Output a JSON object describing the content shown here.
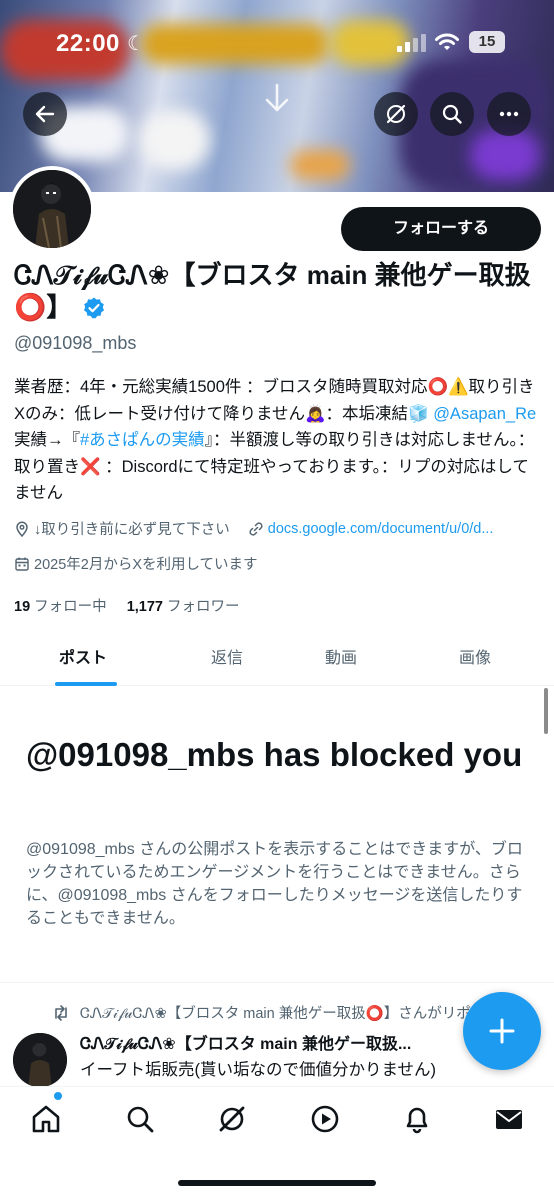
{
  "status_bar": {
    "time": "22:00",
    "battery": "15"
  },
  "profile": {
    "follow_button": "フォローする",
    "display_name": "ᏣᏁ𝒯𝒾𝒻𝓊ᏣᏁ❀【ブロスタ main 兼他ゲー取扱⭕️】",
    "handle": "@091098_mbs",
    "bio": {
      "part1": "業者歴：4年・元総実績1500件 ：ブロスタ随時買取対応⭕️⚠️取り引きXのみ：低レート受け付けて降りません🙇‍♀️：本垢凍結🧊 ",
      "mention": "@Asapan_Re",
      "part2": " 実績→『",
      "hashtag": "#あさぱんの実績",
      "part3": "』：半額渡し等の取り引きは対応しません。：取り置き❌ ：Discordにて特定班やっております。：リプの対応はしてません"
    },
    "location": "↓取り引き前に必ず見て下さい",
    "website": "docs.google.com/document/u/0/d...",
    "joined": "2025年2月からXを利用しています",
    "following_count": "19",
    "following_label": "フォロー中",
    "followers_count": "1,177",
    "followers_label": "フォロワー"
  },
  "tabs": [
    {
      "label": "ポスト",
      "active": true
    },
    {
      "label": "返信",
      "active": false
    },
    {
      "label": "動画",
      "active": false
    },
    {
      "label": "画像",
      "active": false
    }
  ],
  "blocked": {
    "title": "@091098_mbs has blocked you",
    "body": "@091098_mbs さんの公開ポストを表示することはできますが、ブロックされているためエンゲージメントを行うことはできません。さらに、@091098_mbs さんをフォローしたりメッセージを送信したりすることもできません。"
  },
  "post": {
    "repost_line": "ᏣᏁ𝒯𝒾𝒻𝓊ᏣᏁ❀【ブロスタ main 兼他ゲー取扱⭕️】さんがリポスト",
    "author_name": "ᏣᏁ𝒯𝒾𝒻𝓊ᏣᏁ❀【ブロスタ main 兼他ゲー取扱...",
    "text": "イーフト垢販売(貰い垢なので価値分かりません)"
  },
  "colors": {
    "accent": "#1d9bf0",
    "text_primary": "#0f1419",
    "text_secondary": "#536471"
  },
  "icons": {
    "back": "arrow-left-icon",
    "grok": "grok-icon",
    "search": "search-icon",
    "more": "more-icon",
    "compose": "plus-icon",
    "home": "home-icon",
    "explore": "search-icon",
    "grok_nav": "grok-icon",
    "video": "play-icon",
    "notifications": "bell-icon",
    "messages": "mail-icon"
  }
}
